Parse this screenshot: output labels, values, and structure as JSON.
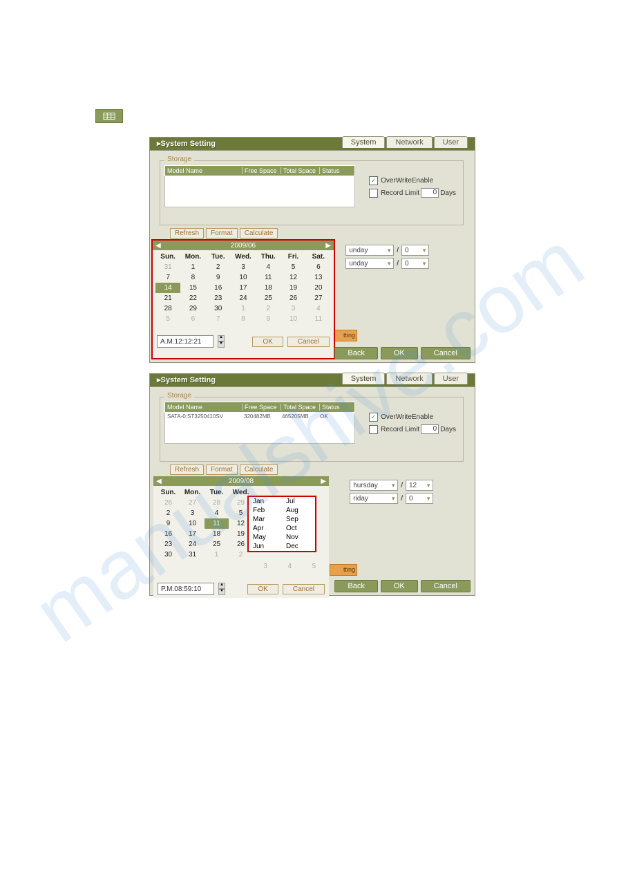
{
  "icon_name": "grid-icon",
  "panel_title": "System Setting",
  "tabs": {
    "system": "System",
    "network": "Network",
    "user": "User"
  },
  "storage": {
    "legend": "Storage",
    "headers": {
      "model": "Model Name",
      "free": "Free Space",
      "total": "Total Space",
      "status": "Status"
    },
    "buttons": {
      "refresh": "Refresh",
      "format": "Format",
      "calculate": "Calculate"
    },
    "overwrite": {
      "label": "OverWriteEnable",
      "checked": true
    },
    "record_limit": {
      "label": "Record Limit",
      "value": "0",
      "unit": "Days",
      "checked": false
    }
  },
  "storage2_row": {
    "model": "SATA-0:ST3250410SV",
    "free": "320482MB",
    "total": "465205MB",
    "status": "OK"
  },
  "storage2_overwrite": {
    "checked": true
  },
  "storage2_record_limit": {
    "value": "0",
    "checked": false
  },
  "calendar1": {
    "title": "2009/06",
    "dow": [
      "Sun.",
      "Mon.",
      "Tue.",
      "Wed.",
      "Thu.",
      "Fri.",
      "Sat."
    ],
    "days": [
      {
        "d": "31",
        "m": true
      },
      {
        "d": "1"
      },
      {
        "d": "2"
      },
      {
        "d": "3"
      },
      {
        "d": "4"
      },
      {
        "d": "5"
      },
      {
        "d": "6"
      },
      {
        "d": "7"
      },
      {
        "d": "8"
      },
      {
        "d": "9"
      },
      {
        "d": "10"
      },
      {
        "d": "11"
      },
      {
        "d": "12"
      },
      {
        "d": "13"
      },
      {
        "d": "14",
        "s": true
      },
      {
        "d": "15"
      },
      {
        "d": "16"
      },
      {
        "d": "17"
      },
      {
        "d": "18"
      },
      {
        "d": "19"
      },
      {
        "d": "20"
      },
      {
        "d": "21"
      },
      {
        "d": "22"
      },
      {
        "d": "23"
      },
      {
        "d": "24"
      },
      {
        "d": "25"
      },
      {
        "d": "26"
      },
      {
        "d": "27"
      },
      {
        "d": "28"
      },
      {
        "d": "29"
      },
      {
        "d": "30"
      },
      {
        "d": "1",
        "m": true
      },
      {
        "d": "2",
        "m": true
      },
      {
        "d": "3",
        "m": true
      },
      {
        "d": "4",
        "m": true
      },
      {
        "d": "5",
        "m": true
      },
      {
        "d": "6",
        "m": true
      },
      {
        "d": "7",
        "m": true
      },
      {
        "d": "8",
        "m": true
      },
      {
        "d": "9",
        "m": true
      },
      {
        "d": "10",
        "m": true
      },
      {
        "d": "11",
        "m": true
      }
    ],
    "time": "A.M.12:12:21",
    "ok": "OK",
    "cancel": "Cancel"
  },
  "dropdowns1": {
    "row1": {
      "day": "unday",
      "num": "0"
    },
    "row2": {
      "day": "unday",
      "num": "0"
    }
  },
  "calendar2": {
    "title": "2009/08",
    "dow": [
      "Sun.",
      "Mon.",
      "Tue.",
      "Wed."
    ],
    "days": [
      {
        "d": "26",
        "m": true
      },
      {
        "d": "27",
        "m": true
      },
      {
        "d": "28",
        "m": true
      },
      {
        "d": "29",
        "m": true
      },
      {
        "d": "2"
      },
      {
        "d": "3"
      },
      {
        "d": "4"
      },
      {
        "d": "5"
      },
      {
        "d": "9"
      },
      {
        "d": "10"
      },
      {
        "d": "11",
        "s": true
      },
      {
        "d": "12"
      },
      {
        "d": "16"
      },
      {
        "d": "17"
      },
      {
        "d": "18"
      },
      {
        "d": "19"
      },
      {
        "d": "23"
      },
      {
        "d": "24"
      },
      {
        "d": "25"
      },
      {
        "d": "26"
      },
      {
        "d": "30"
      },
      {
        "d": "31"
      },
      {
        "d": "1",
        "m": true
      },
      {
        "d": "2",
        "m": true
      }
    ],
    "extra_row": [
      {
        "d": "3",
        "m": true
      },
      {
        "d": "4",
        "m": true
      },
      {
        "d": "5",
        "m": true
      }
    ],
    "months_col1": [
      "Jan",
      "Feb",
      "Mar",
      "Apr",
      "May",
      "Jun"
    ],
    "months_col2": [
      "Jul",
      "Aug",
      "Sep",
      "Oct",
      "Nov",
      "Dec"
    ],
    "time": "P.M.08:59:10",
    "ok": "OK",
    "cancel": "Cancel"
  },
  "dropdowns2": {
    "row1": {
      "day": "hursday",
      "num": "12"
    },
    "row2": {
      "day": "riday",
      "num": "0"
    }
  },
  "strip_label": "tting",
  "bottom": {
    "back": "Back",
    "ok": "OK",
    "cancel": "Cancel"
  },
  "slash": "/"
}
